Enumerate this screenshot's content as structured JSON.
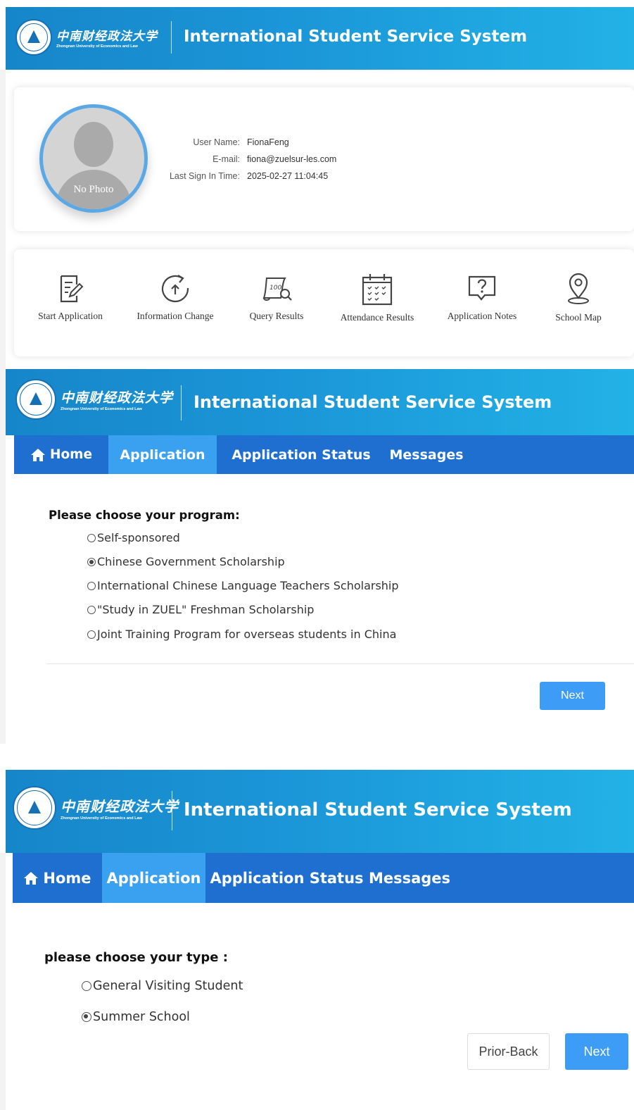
{
  "header": {
    "logo_cn": "中南财经政法大学",
    "logo_en": "Zhongnan University of Economics and Law",
    "title": "International Student Service System"
  },
  "profile": {
    "avatar_caption": "No Photo",
    "user_name_label": "User Name:",
    "user_name": "FionaFeng",
    "email_label": "E-mail:",
    "email": "fiona@zuelsur-les.com",
    "last_sign_label": "Last Sign In Time:",
    "last_sign": "2025-02-27 11:04:45"
  },
  "quick_links": [
    {
      "label": "Start Application",
      "icon": "edit-document-icon"
    },
    {
      "label": "Information Change",
      "icon": "refresh-upload-icon"
    },
    {
      "label": "Query Results",
      "icon": "score-scroll-icon"
    },
    {
      "label": "Attendance Results",
      "icon": "calendar-icon"
    },
    {
      "label": "Application Notes",
      "icon": "question-bubble-icon"
    },
    {
      "label": "School Map",
      "icon": "map-pin-icon"
    }
  ],
  "nav": {
    "home": "Home",
    "application": "Application",
    "application_status": "Application Status",
    "messages": "Messages",
    "active": "Application"
  },
  "program_form": {
    "label": "Please choose your program:",
    "options": [
      {
        "label": "Self-sponsored",
        "checked": false
      },
      {
        "label": "Chinese Government Scholarship",
        "checked": true
      },
      {
        "label": "International Chinese Language Teachers Scholarship",
        "checked": false
      },
      {
        "label": "\"Study in ZUEL\" Freshman Scholarship",
        "checked": false
      },
      {
        "label": "Joint Training Program for overseas students in China",
        "checked": false
      }
    ],
    "next": "Next"
  },
  "type_form": {
    "label": "please choose your type :",
    "options": [
      {
        "label": "General Visiting Student",
        "checked": false
      },
      {
        "label": "Summer School",
        "checked": true
      }
    ],
    "prior_back": "Prior-Back",
    "next": "Next"
  },
  "colors": {
    "header_blue": "#1b96d8",
    "nav_blue": "#1e6fd0",
    "nav_active": "#3aa0f0",
    "button_blue": "#3d9cf5",
    "avatar_ring": "#5aa8e6"
  }
}
